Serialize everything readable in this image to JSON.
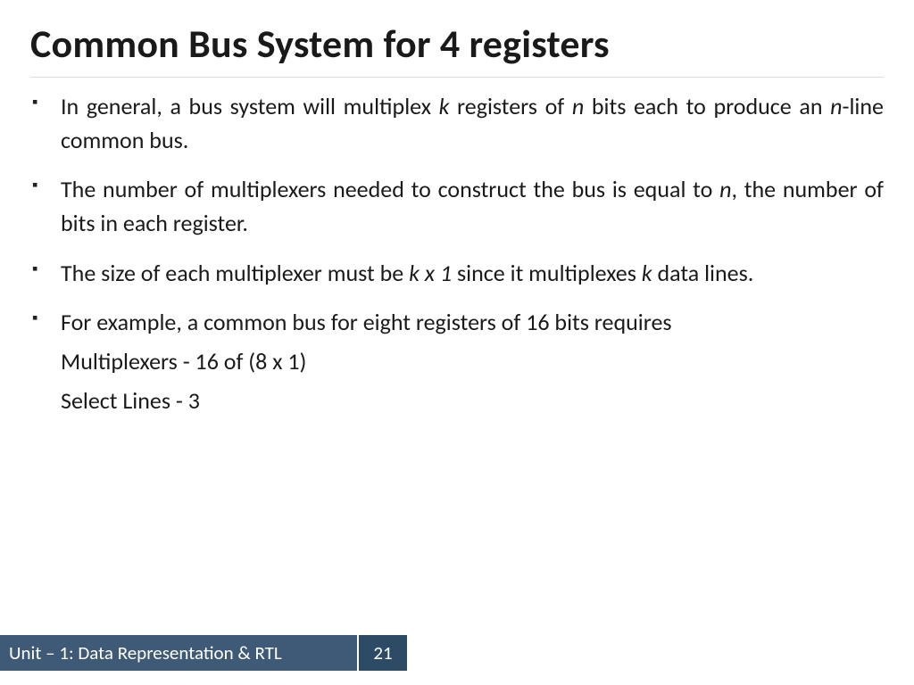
{
  "title": "Common Bus System for 4 registers",
  "bullets": [
    {
      "pre": "In general, a bus system will multiplex ",
      "i1": "k",
      "mid1": " registers of ",
      "i2": "n",
      "mid2": " bits each to produce an ",
      "i3": "n",
      "post": "-line common bus."
    },
    {
      "pre": "The number of multiplexers needed to construct the bus is equal to ",
      "i1": "n",
      "post": ", the number of bits in each register."
    },
    {
      "pre": "The size of each multiplexer must be ",
      "i1": "k x 1",
      "mid1": " since it multiplexes ",
      "i2": "k",
      "post": " data lines."
    },
    {
      "pre": "For example, a common bus for eight registers of 16 bits requires"
    }
  ],
  "subs": {
    "line1": "Multiplexers - 16 of (8 x 1)",
    "line2": "Select Lines - 3"
  },
  "footer": {
    "unit": "Unit – 1: Data Representation & RTL",
    "page": "21"
  }
}
